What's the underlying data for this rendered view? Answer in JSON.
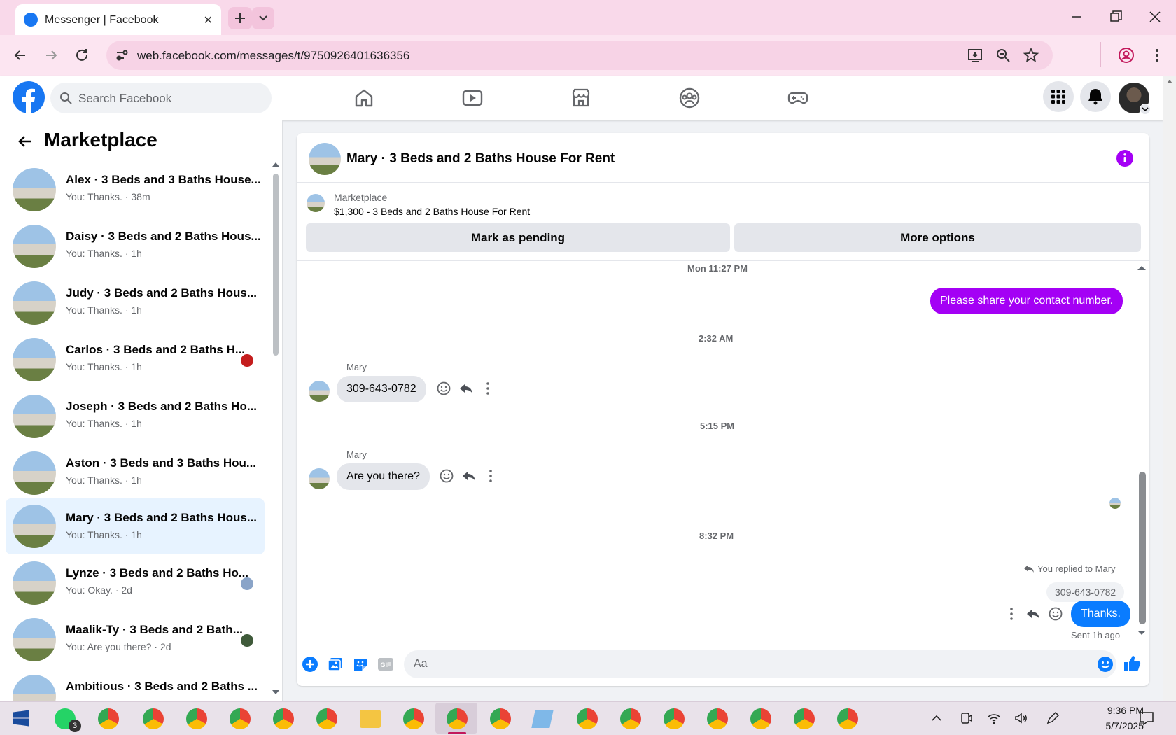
{
  "browser": {
    "tab_title": "Messenger | Facebook",
    "url": "web.facebook.com/messages/t/9750926401636356"
  },
  "header": {
    "search_placeholder": "Search Facebook"
  },
  "left_panel": {
    "title": "Marketplace",
    "conversations": [
      {
        "name": "Alex · 3 Beds and 3 Baths House...",
        "preview": "You: Thanks. · 38m",
        "badge_color": ""
      },
      {
        "name": "Daisy · 3 Beds and 2 Baths Hous...",
        "preview": "You: Thanks. · 1h",
        "badge_color": ""
      },
      {
        "name": "Judy · 3 Beds and 2 Baths Hous...",
        "preview": "You: Thanks. · 1h",
        "badge_color": ""
      },
      {
        "name": "Carlos · 3 Beds and 2 Baths H...",
        "preview": "You: Thanks. · 1h",
        "badge_color": "#c41d1d"
      },
      {
        "name": "Joseph · 3 Beds and 2 Baths Ho...",
        "preview": "You: Thanks. · 1h",
        "badge_color": ""
      },
      {
        "name": "Aston · 3 Beds and 3 Baths Hou...",
        "preview": "You: Thanks. · 1h",
        "badge_color": ""
      },
      {
        "name": "Mary · 3 Beds and 2 Baths Hous...",
        "preview": "You: Thanks. · 1h",
        "badge_color": ""
      },
      {
        "name": "Lynze · 3 Beds and 2 Baths Ho...",
        "preview": "You: Okay. · 2d",
        "badge_color": "#8aa4c8"
      },
      {
        "name": "Maalik-Ty · 3 Beds and 2 Bath...",
        "preview": "You: Are you there? · 2d",
        "badge_color": "#3f5a3a"
      },
      {
        "name": "Ambitious · 3 Beds and 2 Baths ...",
        "preview": "",
        "badge_color": ""
      }
    ]
  },
  "chat": {
    "title": "Mary · 3 Beds and 2 Baths House For Rent",
    "marketplace_label": "Marketplace",
    "listing": "$1,300 - 3 Beds and 2 Baths House For Rent",
    "mark_pending": "Mark as pending",
    "more_options": "More options",
    "timestamps": [
      "Mon 11:27 PM",
      "2:32 AM",
      "5:15 PM",
      "8:32 PM"
    ],
    "outgoing_1": "Please share your contact number.",
    "sender_name": "Mary",
    "incoming_1": "309-643-0782",
    "incoming_2": "Are you there?",
    "replied_to": "You replied to Mary",
    "quoted": "309-643-0782",
    "outgoing_2": "Thanks.",
    "sent_status": "Sent 1h ago",
    "composer_placeholder": "Aa"
  },
  "colors": {
    "facebook_blue": "#1877f2",
    "messenger_purple": "#a400f5",
    "reply_blue": "#0a7cff"
  },
  "taskbar": {
    "whatsapp_badge": "3",
    "time": "9:36 PM",
    "date": "5/7/2025"
  }
}
